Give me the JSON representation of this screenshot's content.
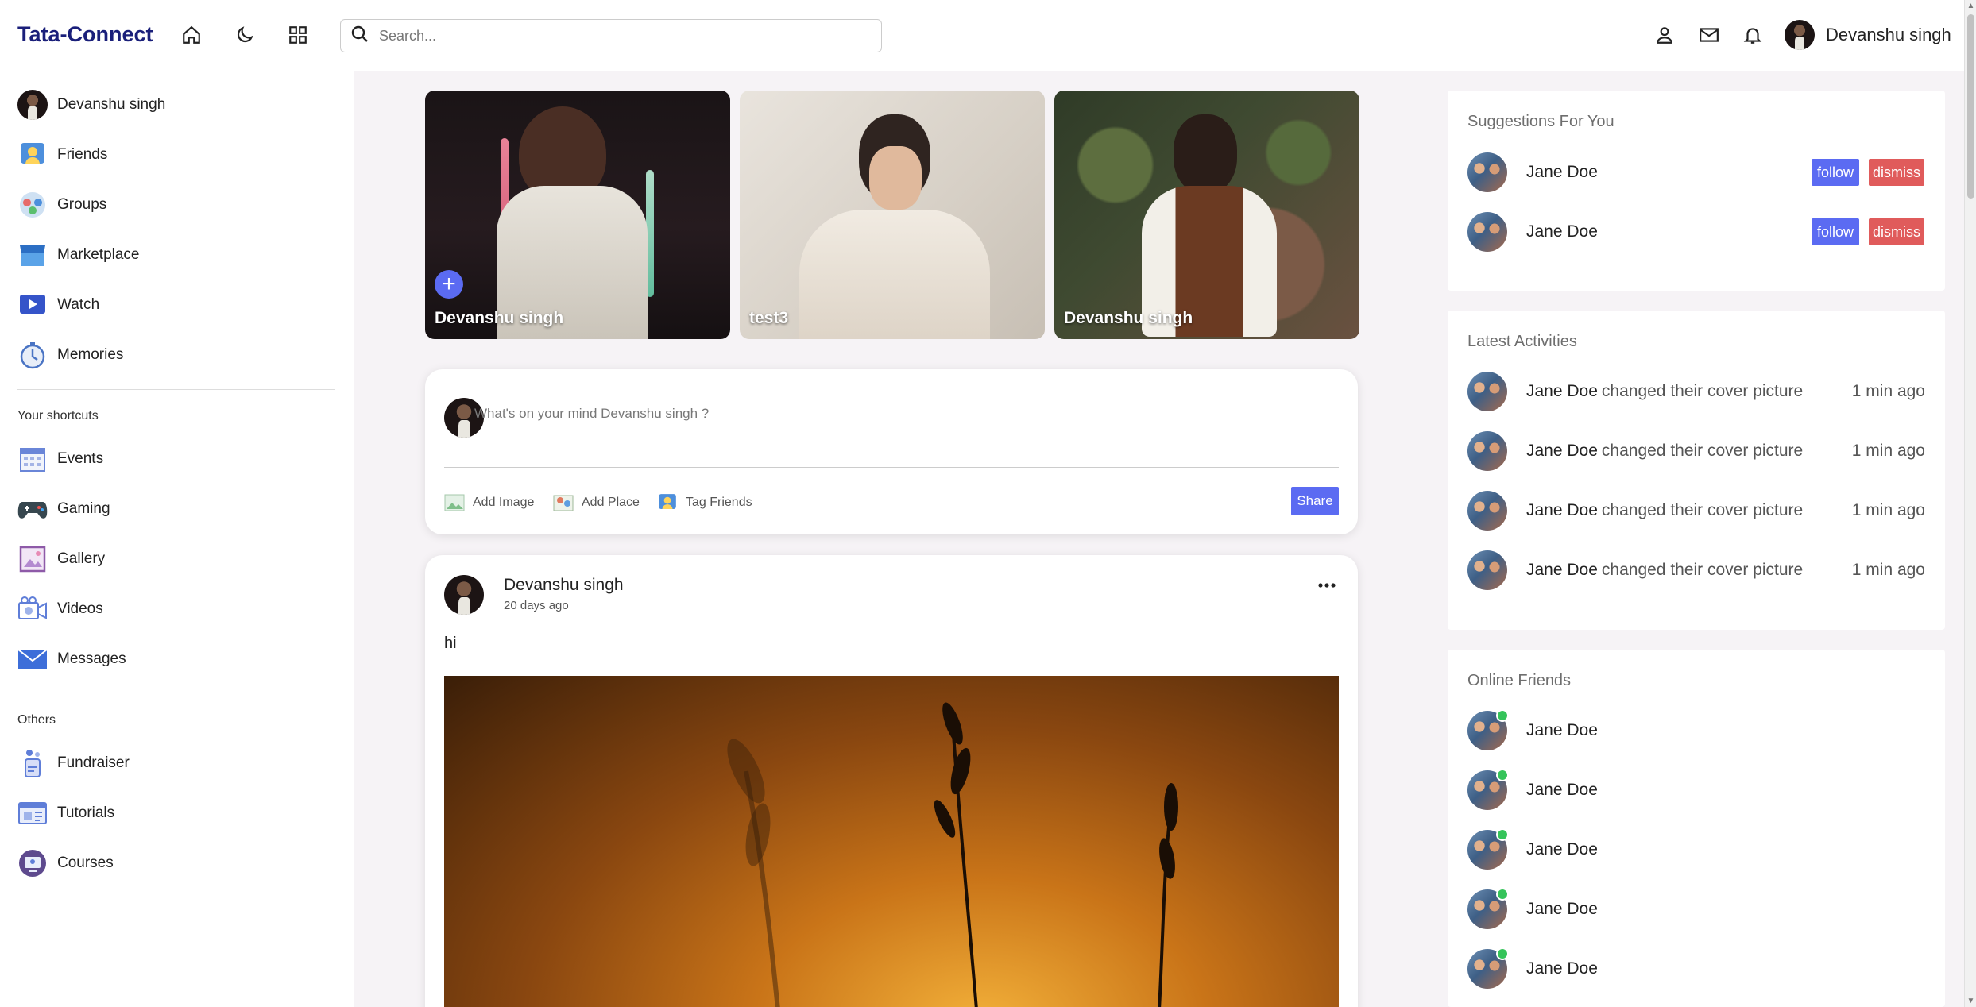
{
  "navbar": {
    "logo": "Tata-Connect",
    "search_placeholder": "Search...",
    "user_name": "Devanshu singh",
    "icons": [
      "home-icon",
      "moon-icon",
      "grid-icon",
      "person-icon",
      "mail-icon",
      "bell-icon"
    ]
  },
  "sidebar": {
    "profile_name": "Devanshu singh",
    "menu": [
      {
        "label": "Friends",
        "icon": "friends-icon"
      },
      {
        "label": "Groups",
        "icon": "groups-icon"
      },
      {
        "label": "Marketplace",
        "icon": "marketplace-icon"
      },
      {
        "label": "Watch",
        "icon": "watch-icon"
      },
      {
        "label": "Memories",
        "icon": "memories-icon"
      }
    ],
    "shortcuts_heading": "Your shortcuts",
    "shortcuts": [
      {
        "label": "Events",
        "icon": "events-icon"
      },
      {
        "label": "Gaming",
        "icon": "gaming-icon"
      },
      {
        "label": "Gallery",
        "icon": "gallery-icon"
      },
      {
        "label": "Videos",
        "icon": "videos-icon"
      },
      {
        "label": "Messages",
        "icon": "messages-icon"
      }
    ],
    "others_heading": "Others",
    "others": [
      {
        "label": "Fundraiser",
        "icon": "fundraiser-icon"
      },
      {
        "label": "Tutorials",
        "icon": "tutorials-icon"
      },
      {
        "label": "Courses",
        "icon": "courses-icon"
      }
    ]
  },
  "stories": [
    {
      "name": "Devanshu singh"
    },
    {
      "name": "test3"
    },
    {
      "name": "Devanshu singh"
    }
  ],
  "share": {
    "placeholder": "What's on your mind Devanshu singh ?",
    "add_image": "Add Image",
    "add_place": "Add Place",
    "tag_friends": "Tag Friends",
    "share_label": "Share"
  },
  "post": {
    "author": "Devanshu singh",
    "time": "20 days ago",
    "text": "hi"
  },
  "suggestions": {
    "title": "Suggestions For You",
    "follow_label": "follow",
    "dismiss_label": "dismiss",
    "items": [
      {
        "name": "Jane Doe"
      },
      {
        "name": "Jane Doe"
      }
    ]
  },
  "activities": {
    "title": "Latest Activities",
    "items": [
      {
        "name": "Jane Doe",
        "action": "changed their cover picture",
        "time": "1 min ago"
      },
      {
        "name": "Jane Doe",
        "action": "changed their cover picture",
        "time": "1 min ago"
      },
      {
        "name": "Jane Doe",
        "action": "changed their cover picture",
        "time": "1 min ago"
      },
      {
        "name": "Jane Doe",
        "action": "changed their cover picture",
        "time": "1 min ago"
      }
    ]
  },
  "online": {
    "title": "Online Friends",
    "items": [
      {
        "name": "Jane Doe"
      },
      {
        "name": "Jane Doe"
      },
      {
        "name": "Jane Doe"
      },
      {
        "name": "Jane Doe"
      },
      {
        "name": "Jane Doe"
      }
    ]
  },
  "colors": {
    "brand": "#1a1f7a",
    "accent": "#5b6bf2",
    "danger": "#e05b5b",
    "online": "#35c35a"
  }
}
